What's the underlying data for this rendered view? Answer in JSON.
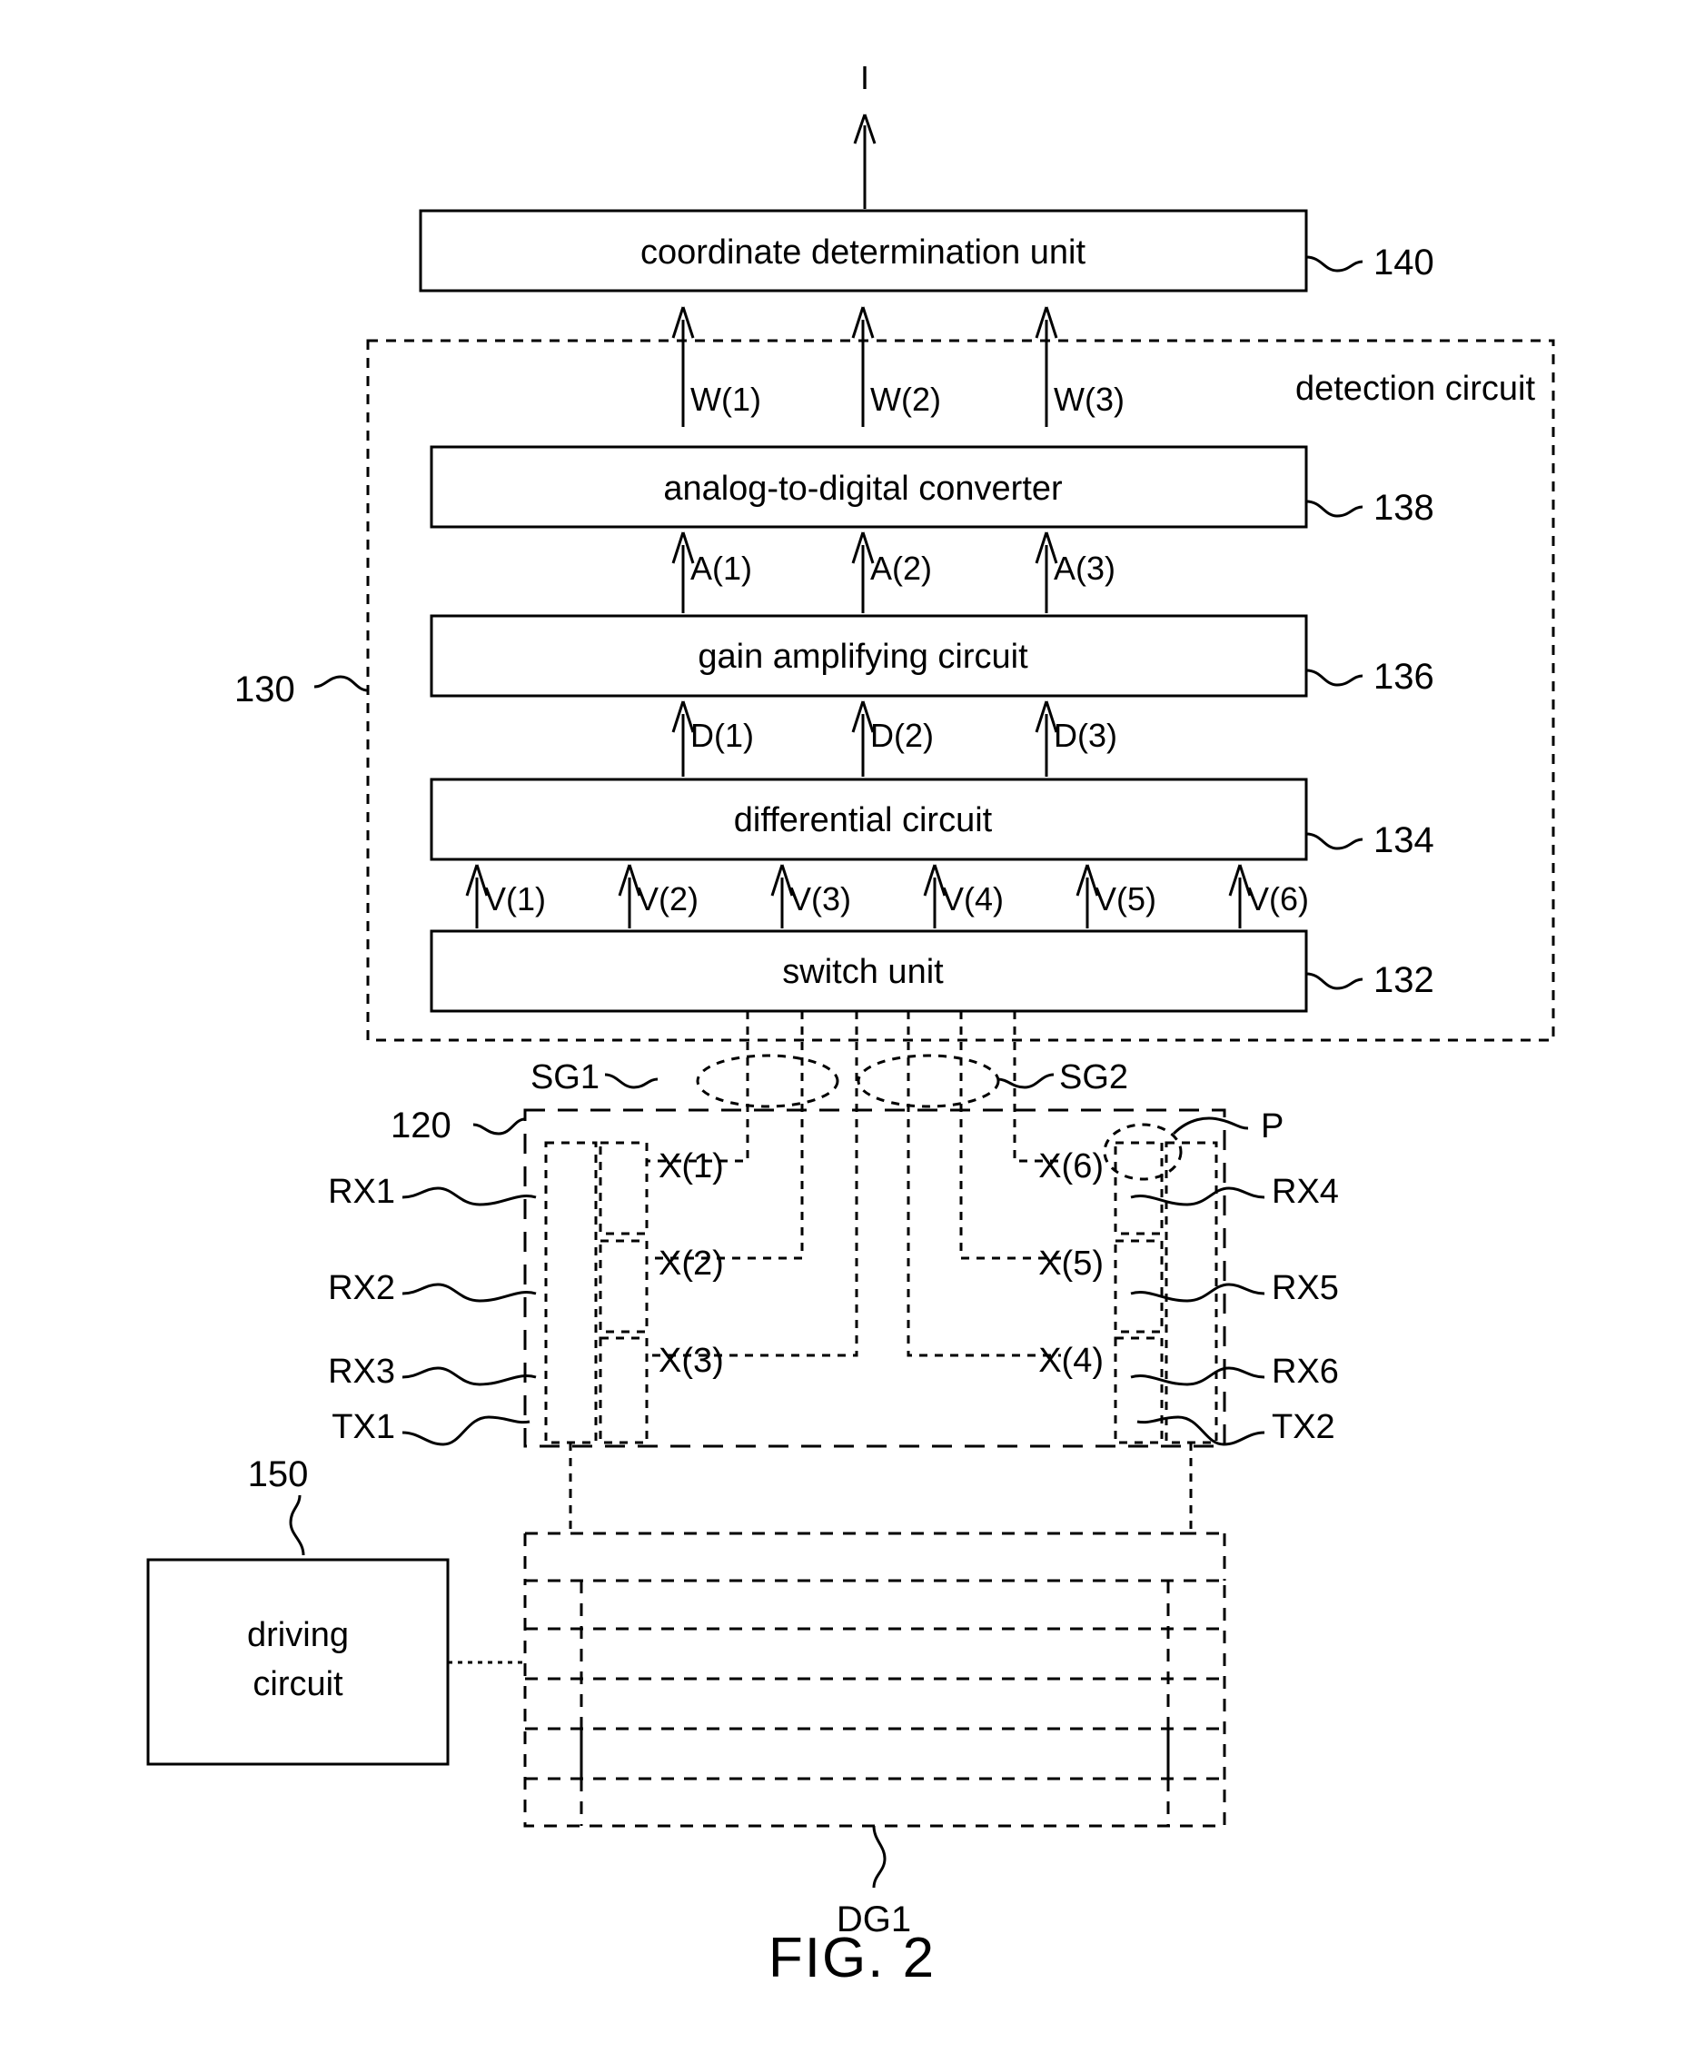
{
  "figure": {
    "caption": "FIG. 2",
    "output_label": "I"
  },
  "blocks": {
    "coordinate_unit": {
      "label": "coordinate determination unit",
      "ref": "140"
    },
    "adc": {
      "label": "analog-to-digital converter",
      "ref": "138"
    },
    "gain": {
      "label": "gain amplifying circuit",
      "ref": "136"
    },
    "differential": {
      "label": "differential circuit",
      "ref": "134"
    },
    "switch": {
      "label": "switch unit",
      "ref": "132"
    },
    "driving": {
      "label": "driving\ncircuit",
      "label_line1": "driving",
      "label_line2": "circuit",
      "ref": "150"
    }
  },
  "detection_circuit": {
    "label": "detection circuit",
    "ref": "130"
  },
  "panel": {
    "ref": "120",
    "pad_label": "P",
    "display_ref": "DG1"
  },
  "signals": {
    "w": [
      "W(1)",
      "W(2)",
      "W(3)"
    ],
    "a": [
      "A(1)",
      "A(2)",
      "A(3)"
    ],
    "d": [
      "D(1)",
      "D(2)",
      "D(3)"
    ],
    "v": [
      "V(1)",
      "V(2)",
      "V(3)",
      "V(4)",
      "V(5)",
      "V(6)"
    ],
    "sense_groups": [
      "SG1",
      "SG2"
    ]
  },
  "electrodes": {
    "x_left": [
      "X(1)",
      "X(2)",
      "X(3)"
    ],
    "x_right": [
      "X(6)",
      "X(5)",
      "X(4)"
    ],
    "rx_left": [
      "RX1",
      "RX2",
      "RX3"
    ],
    "rx_right": [
      "RX4",
      "RX5",
      "RX6"
    ],
    "tx_left": "TX1",
    "tx_right": "TX2"
  },
  "colors": {
    "line": "#000000",
    "background": "#ffffff"
  }
}
